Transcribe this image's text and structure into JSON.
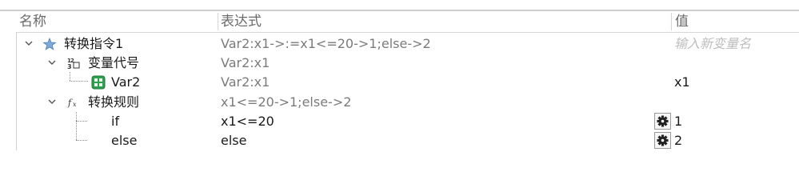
{
  "columns": {
    "name": "名称",
    "expression": "表达式",
    "value": "值"
  },
  "rows": [
    {
      "name": "转换指令1",
      "expression": "Var2:x1->:=x1<=20->1;else->2",
      "value": "输入新变量名",
      "icon": "star-icon",
      "expanded": true
    },
    {
      "name": "变量代号",
      "expression": "Var2:x1",
      "value": "",
      "icon": "numeric-variable-icon",
      "expanded": true
    },
    {
      "name": "Var2",
      "expression": "Var2:x1",
      "value": "x1",
      "icon": "green-variable-icon"
    },
    {
      "name": "转换规则",
      "expression": "x1<=20->1;else->2",
      "value": "",
      "icon": "fx-function-icon",
      "expanded": true
    },
    {
      "name": "if",
      "expression": "x1<=20",
      "value": "1",
      "icon": "gear-icon"
    },
    {
      "name": "else",
      "expression": "else",
      "value": "2",
      "icon": "gear-icon"
    }
  ]
}
